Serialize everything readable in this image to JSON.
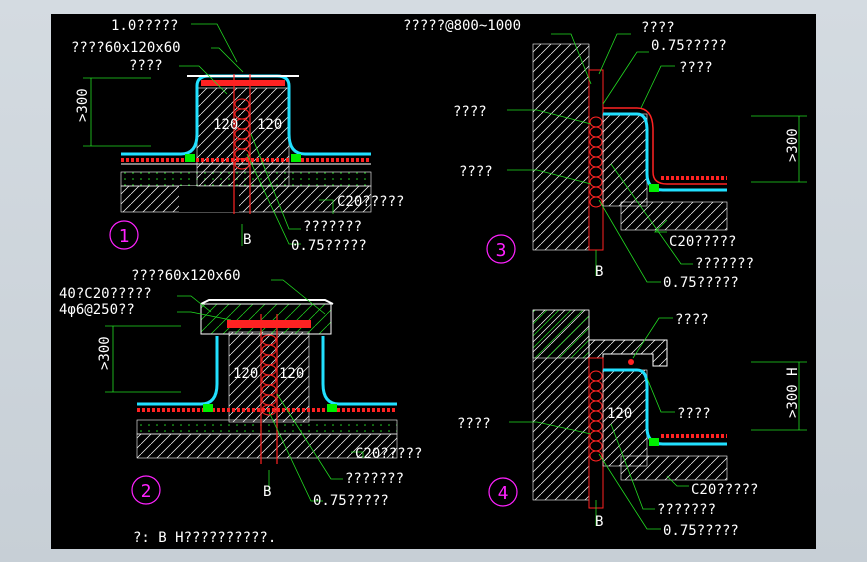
{
  "colors": {
    "background": "#000000",
    "frame": "#cfd6dc",
    "leader": "#22dd22",
    "text": "#ffffff",
    "red": "#ff2222",
    "cyan": "#22e0ff",
    "magenta": "#ff22ff",
    "green_fill": "#00ee00"
  },
  "detail1": {
    "number": "1",
    "labels": {
      "membrane": "1.0?????",
      "cap_size": "????60x120x60",
      "top": "????",
      "height": ">300",
      "dim_left": "120",
      "dim_right": "120",
      "concrete": "C20?????",
      "sealant": "???????",
      "flashing": "0.75?????",
      "section": "B"
    }
  },
  "detail2": {
    "number": "2",
    "labels": {
      "cap_size": "????60x120x60",
      "concrete": "40?C20?????",
      "rebar": "4φ6@250??",
      "height": ">300",
      "dim_left": "120",
      "dim_right": "120",
      "concrete_base": "C20?????",
      "sealant": "???????",
      "flashing": "0.75?????",
      "section": "B"
    }
  },
  "detail3": {
    "number": "3",
    "labels": {
      "anchor": "?????@800~1000",
      "top": "????",
      "flashing_top": "0.75?????",
      "right_top": "????",
      "left_upper": "????",
      "left_lower": "????",
      "height": ">300",
      "concrete": "C20?????",
      "sealant": "???????",
      "flashing": "0.75?????",
      "section": "B"
    }
  },
  "detail4": {
    "number": "4",
    "labels": {
      "top": "????",
      "right": "????",
      "left": "????",
      "dim": "120",
      "height": ">300 H",
      "concrete": "C20?????",
      "sealant": "???????",
      "flashing": "0.75?????",
      "section": "B"
    }
  },
  "note": "?:  B  H??????????."
}
